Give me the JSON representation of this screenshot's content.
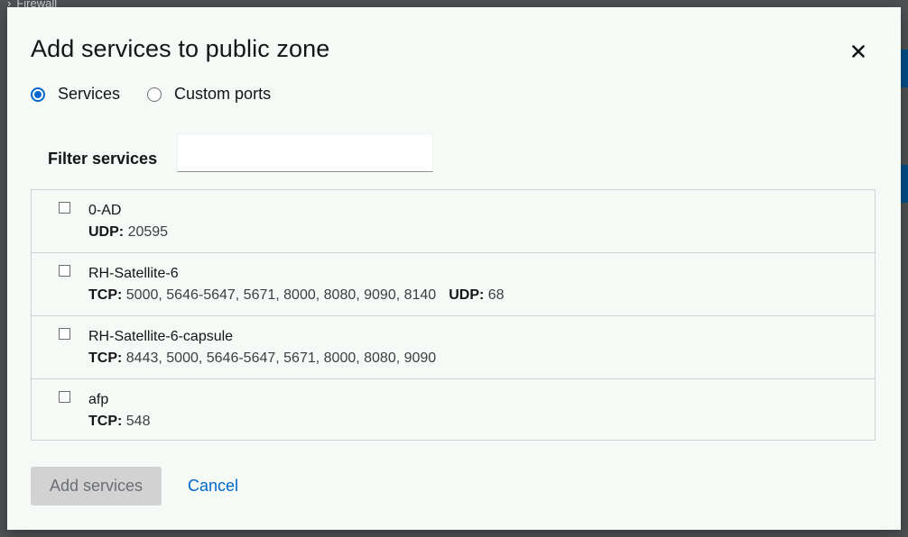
{
  "background": {
    "breadcrumb": "Firewall"
  },
  "modal": {
    "title": "Add services to public zone",
    "close_label": "×",
    "mode_options": [
      {
        "label": "Services",
        "selected": true
      },
      {
        "label": "Custom ports",
        "selected": false
      }
    ],
    "filter": {
      "label": "Filter services",
      "value": "",
      "placeholder": ""
    },
    "services": [
      {
        "name": "0-AD",
        "ports": [
          {
            "proto": "UDP:",
            "value": "20595"
          }
        ]
      },
      {
        "name": "RH-Satellite-6",
        "ports": [
          {
            "proto": "TCP:",
            "value": "5000, 5646-5647, 5671, 8000, 8080, 9090, 8140"
          },
          {
            "proto": "UDP:",
            "value": "68"
          }
        ]
      },
      {
        "name": "RH-Satellite-6-capsule",
        "ports": [
          {
            "proto": "TCP:",
            "value": "8443, 5000, 5646-5647, 5671, 8000, 8080, 9090"
          }
        ]
      },
      {
        "name": "afp",
        "ports": [
          {
            "proto": "TCP:",
            "value": "548"
          }
        ]
      }
    ],
    "actions": {
      "add_label": "Add services",
      "add_enabled": false,
      "cancel_label": "Cancel"
    }
  },
  "colors": {
    "accent": "#0066cc",
    "modal_bg": "#f5faf6",
    "disabled_btn_bg": "#d2d2d2"
  }
}
